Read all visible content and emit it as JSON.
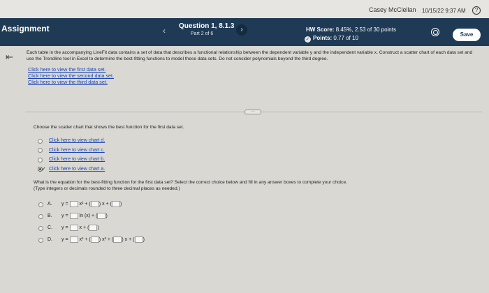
{
  "topbar": {
    "user_name": "Casey McClellan",
    "date": "10/15/22 9:37 AM",
    "help_icon": "?"
  },
  "header": {
    "assignment_label": "Assignment",
    "question_title": "Question 1, 8.1.3",
    "question_part": "Part 2 of 6",
    "hw_score_label": "HW Score:",
    "hw_score_value": "8.45%, 2.53 of 30 points",
    "points_label": "Points:",
    "points_value": "0.77 of 10",
    "save_label": "Save",
    "prev_arrow": "‹",
    "next_arrow": "›"
  },
  "instructions": "Each table in the accompanying LineFit data contains a set of data that describes a functional relationship between the dependent variable y and the independent variable x. Construct a scatter chart of each data set and use the Trendline tool in Excel to determine the best-fitting functions to model these data sets. Do not consider polynomials beyond the third degree.",
  "data_links": [
    "Click here to view the first data set.",
    "Click here to view the second data set.",
    "Click here to view the third data set."
  ],
  "question1": {
    "prompt": "Choose the scatter chart that shows the best function for the first data set.",
    "options": [
      {
        "label": "Click here to view chart d.",
        "selected": false
      },
      {
        "label": "Click here to view chart c.",
        "selected": false
      },
      {
        "label": "Click here to view chart b.",
        "selected": false
      },
      {
        "label": "Click here to view chart a.",
        "selected": true
      }
    ]
  },
  "question2": {
    "prompt_line1": "What is the equation for the best-fitting function for the first data set? Select the correct choice below and fill in any answer boxes to complete your choice.",
    "prompt_line2": "(Type integers or decimals rounded to three decimal places as needed.)",
    "options": [
      {
        "letter": "A.",
        "parts": [
          "y =",
          "x² +",
          "x +"
        ]
      },
      {
        "letter": "B.",
        "parts": [
          "y =",
          "ln (x) +"
        ]
      },
      {
        "letter": "C.",
        "parts": [
          "y =",
          "x +"
        ]
      },
      {
        "letter": "D.",
        "parts": [
          "y =",
          "x³ +",
          "x² +",
          "x +"
        ]
      }
    ]
  },
  "colors": {
    "header_bg": "#1f3a54",
    "link": "#1a46b8",
    "page_bg": "#d9d8d3"
  }
}
